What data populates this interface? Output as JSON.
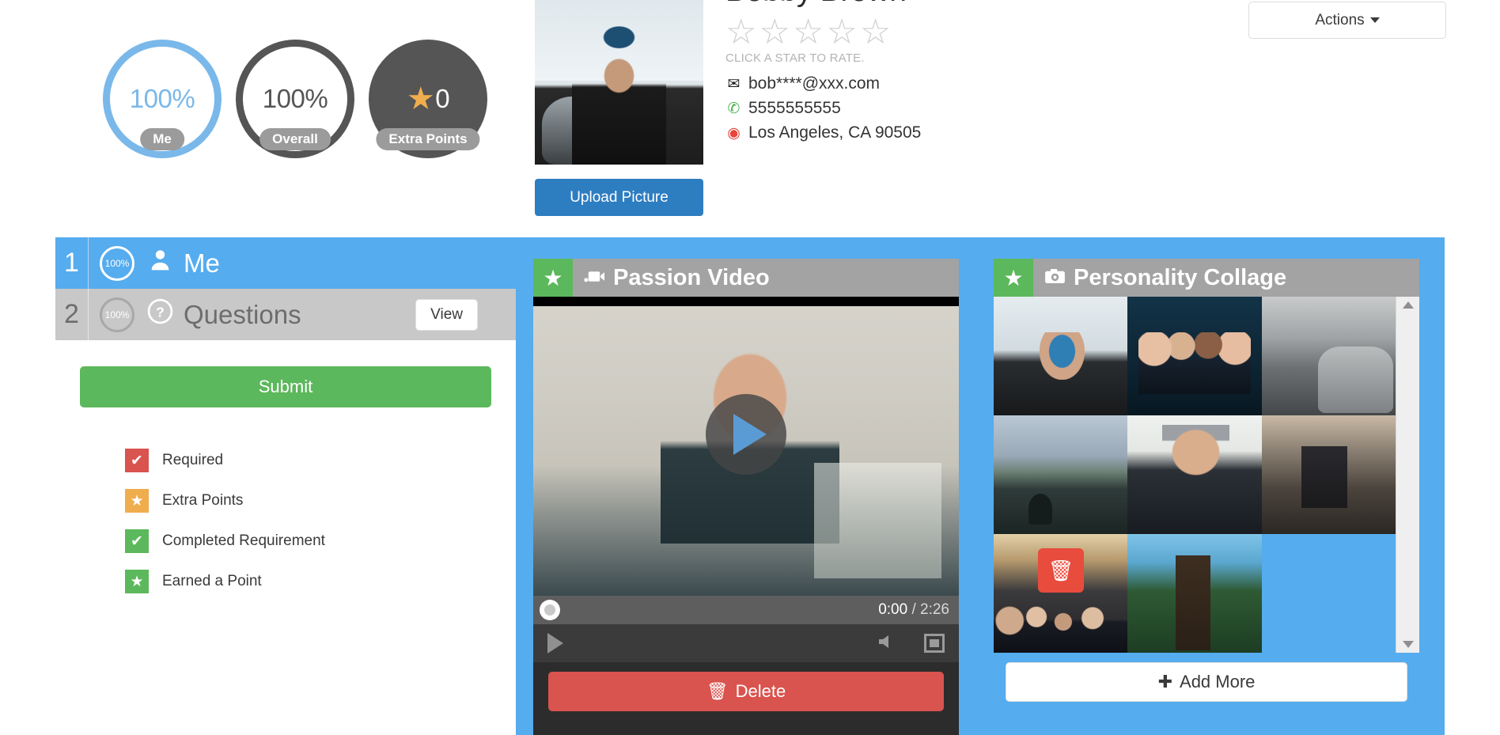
{
  "badges": [
    {
      "value": "100%",
      "label": "Me",
      "style": "blue"
    },
    {
      "value": "100%",
      "label": "Overall",
      "style": "dark"
    },
    {
      "value": "0",
      "label": "Extra Points",
      "style": "filled",
      "star": "★"
    }
  ],
  "profile": {
    "name": "Bobby Brown",
    "rating_hint": "CLICK A STAR TO RATE.",
    "stars": [
      "☆",
      "☆",
      "☆",
      "☆",
      "☆"
    ],
    "email": "bob****@xxx.com",
    "phone": "5555555555",
    "location": "Los Angeles, CA 90505",
    "upload_label": "Upload Picture",
    "mail_icon": "✉",
    "phone_icon": "✆",
    "pin_icon": "◉"
  },
  "actions": {
    "label": "Actions"
  },
  "steps": [
    {
      "num": "1",
      "pct": "100%",
      "icon": "P",
      "label": "Me",
      "state": "active"
    },
    {
      "num": "2",
      "pct": "100%",
      "icon": "?",
      "label": "Questions",
      "state": "inactive",
      "button": "View"
    }
  ],
  "submit": {
    "label": "Submit"
  },
  "legend": [
    {
      "color": "red",
      "glyph": "✔",
      "label": "Required"
    },
    {
      "color": "orange",
      "glyph": "★",
      "label": "Extra Points"
    },
    {
      "color": "green",
      "glyph": "✔",
      "label": "Completed Requirement"
    },
    {
      "color": "green",
      "glyph": "★",
      "label": "Earned a Point"
    }
  ],
  "video": {
    "star": "★",
    "icon": "🎥",
    "title": "Passion Video",
    "current_time": "0:00",
    "separator": "/",
    "duration": "2:26",
    "delete_label": "Delete",
    "delete_icon": "🗑",
    "volume_icon": "🔊"
  },
  "collage": {
    "star": "★",
    "icon": "📷",
    "title": "Personality Collage",
    "photos": [
      "p1",
      "p2",
      "p3",
      "p4",
      "p5",
      "p6",
      "p7",
      "p8"
    ],
    "delete_icon": "🗑",
    "add_more_label": "Add More",
    "add_more_icon": "✚"
  },
  "colors": {
    "accent_blue": "#55acee",
    "light_blue": "#7ab8ea",
    "green": "#5cb85c",
    "red": "#d9534f",
    "orange": "#f0ad4e",
    "gray": "#9b9b9b"
  }
}
